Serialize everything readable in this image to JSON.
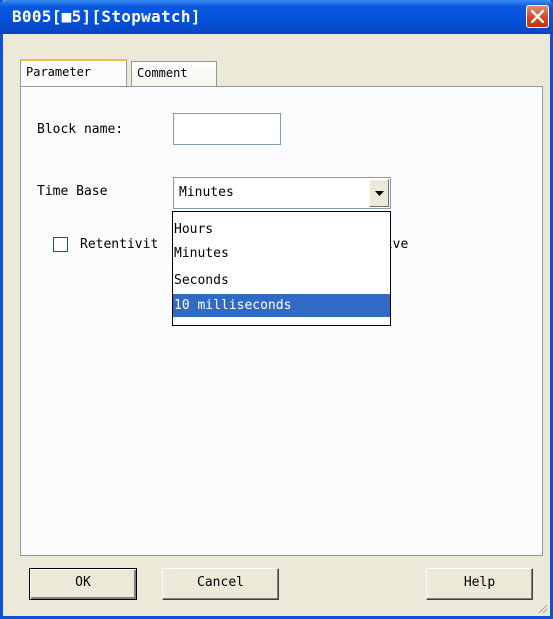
{
  "window": {
    "title": "B005[■5][Stopwatch]"
  },
  "tabs": [
    {
      "label": "Parameter",
      "active": true
    },
    {
      "label": "Comment",
      "active": false
    }
  ],
  "form": {
    "block_name_label": "Block name:",
    "block_name_value": "",
    "time_base_label": "Time Base",
    "time_base_value": "Minutes",
    "retentivity_label_left": "Retentivit",
    "retentivity_label_right": "tive",
    "retentivity_checked": false
  },
  "dropdown": {
    "options": [
      "Hours",
      "Minutes",
      "Seconds",
      "10 milliseconds"
    ],
    "highlighted": "10 milliseconds"
  },
  "buttons": {
    "ok": "OK",
    "cancel": "Cancel",
    "help": "Help"
  },
  "colors": {
    "titlebar": "#0351da",
    "selection": "#316ac5",
    "dialog_bg": "#ece9d8",
    "close_button": "#d5401d"
  },
  "icons": {
    "close": "close-icon",
    "dropdown_arrow": "chevron-down-icon",
    "resize": "resize-grip-icon"
  }
}
